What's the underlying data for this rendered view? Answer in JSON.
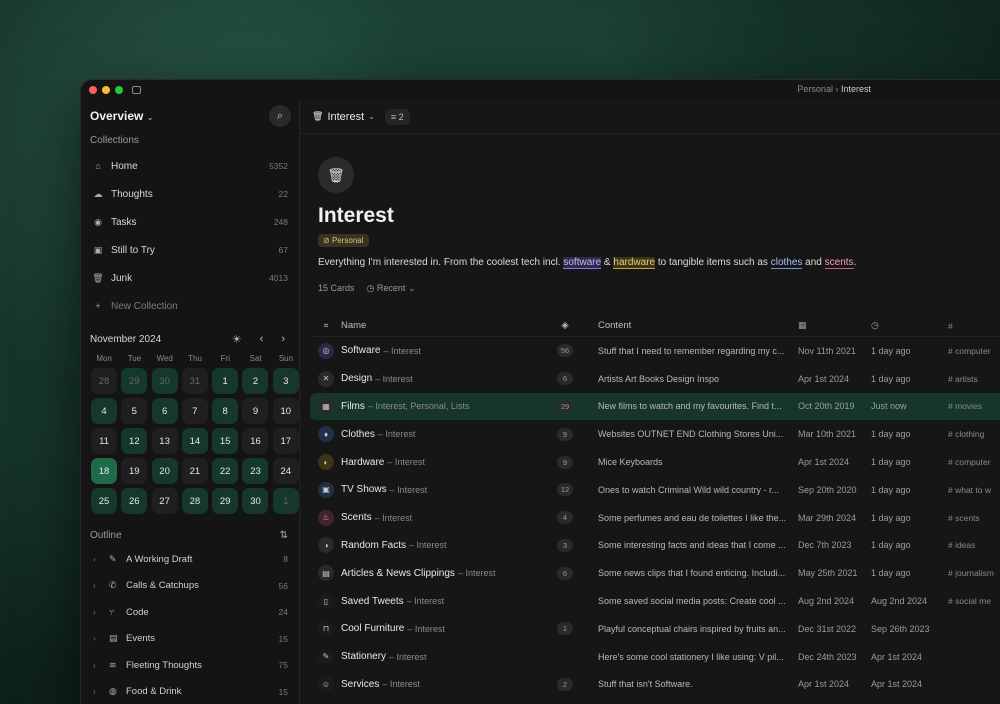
{
  "window": {
    "breadcrumb": {
      "parent": "Personal",
      "separator": "›",
      "current": "Interest"
    }
  },
  "sidebar": {
    "title": "Overview",
    "collections_label": "Collections",
    "collections": [
      {
        "label": "Home",
        "count": "5352",
        "icon": "⌂"
      },
      {
        "label": "Thoughts",
        "count": "22",
        "icon": "☁"
      },
      {
        "label": "Tasks",
        "count": "248",
        "icon": "◉"
      },
      {
        "label": "Still to Try",
        "count": "67",
        "icon": "▣"
      },
      {
        "label": "Junk",
        "count": "4013",
        "icon": "🗑"
      }
    ],
    "new_collection": "New Collection",
    "calendar": {
      "month": "November 2024",
      "weekdays": [
        "Mon",
        "Tue",
        "Wed",
        "Thu",
        "Fri",
        "Sat",
        "Sun"
      ],
      "days": [
        {
          "d": "28",
          "s": "muted"
        },
        {
          "d": "29",
          "s": "muted g"
        },
        {
          "d": "30",
          "s": "muted g"
        },
        {
          "d": "31",
          "s": "muted"
        },
        {
          "d": "1",
          "s": "g"
        },
        {
          "d": "2",
          "s": "g"
        },
        {
          "d": "3",
          "s": "g"
        },
        {
          "d": "4",
          "s": "g"
        },
        {
          "d": "5",
          "s": ""
        },
        {
          "d": "6",
          "s": "g"
        },
        {
          "d": "7",
          "s": ""
        },
        {
          "d": "8",
          "s": "g"
        },
        {
          "d": "9",
          "s": ""
        },
        {
          "d": "10",
          "s": ""
        },
        {
          "d": "11",
          "s": ""
        },
        {
          "d": "12",
          "s": "g"
        },
        {
          "d": "13",
          "s": ""
        },
        {
          "d": "14",
          "s": "g"
        },
        {
          "d": "15",
          "s": "g"
        },
        {
          "d": "16",
          "s": ""
        },
        {
          "d": "17",
          "s": ""
        },
        {
          "d": "18",
          "s": "hl"
        },
        {
          "d": "19",
          "s": ""
        },
        {
          "d": "20",
          "s": "g"
        },
        {
          "d": "21",
          "s": ""
        },
        {
          "d": "22",
          "s": "g"
        },
        {
          "d": "23",
          "s": "g"
        },
        {
          "d": "24",
          "s": ""
        },
        {
          "d": "25",
          "s": "g"
        },
        {
          "d": "26",
          "s": "g"
        },
        {
          "d": "27",
          "s": ""
        },
        {
          "d": "28",
          "s": "g"
        },
        {
          "d": "29",
          "s": "g"
        },
        {
          "d": "30",
          "s": "g"
        },
        {
          "d": "1",
          "s": "muted g"
        }
      ]
    },
    "outline_label": "Outline",
    "outline": [
      {
        "label": "A Working Draft",
        "count": "8",
        "icon": "✎"
      },
      {
        "label": "Calls & Catchups",
        "count": "56",
        "icon": "✆"
      },
      {
        "label": "Code",
        "count": "24",
        "icon": "⑂"
      },
      {
        "label": "Events",
        "count": "15",
        "icon": "▤"
      },
      {
        "label": "Fleeting Thoughts",
        "count": "75",
        "icon": "≋"
      },
      {
        "label": "Food & Drink",
        "count": "15",
        "icon": "◍"
      }
    ]
  },
  "main": {
    "toolbar": {
      "title": "Interest",
      "filter_count": "2"
    },
    "title": "Interest",
    "tag": "Personal",
    "description": {
      "p1": "Everything I'm interested in. From the coolest tech incl. ",
      "software": "software",
      "amp": " & ",
      "hardware": "hardware",
      "p2": " to tangible items such as ",
      "clothes": "clothes",
      "and": " and ",
      "scents": "scents",
      "end": "."
    },
    "meta": {
      "cards": "15 Cards",
      "sort": "Recent"
    },
    "columns": {
      "name": "Name",
      "content": "Content"
    },
    "rows": [
      {
        "name": "Software",
        "parent": "– Interest",
        "count": "56",
        "content": "Stuff that I need to remember regarding my c...",
        "created": "Nov 11th 2021",
        "updated": "1 day ago",
        "tag": "# computer",
        "icon": "◎",
        "color": "#2e2746",
        "sel": false
      },
      {
        "name": "Design",
        "parent": "– Interest",
        "count": "6",
        "content": "Artists Art Books Design Inspo",
        "created": "Apr 1st 2024",
        "updated": "1 day ago",
        "tag": "# artists",
        "icon": "✕",
        "color": "#2a2a2a",
        "sel": false
      },
      {
        "name": "Films",
        "parent": "– Interest, Personal, Lists",
        "count": "29",
        "content": "New films to watch and my favourites. Find t...",
        "created": "Oct 20th 2019",
        "updated": "Just now",
        "tag": "# movies",
        "icon": "▦",
        "color": "#2a2a2a",
        "sel": true
      },
      {
        "name": "Clothes",
        "parent": "– Interest",
        "count": "9",
        "content": "Websites OUTNET END Clothing Stores Uni...",
        "created": "Mar 10th 2021",
        "updated": "1 day ago",
        "tag": "# clothing",
        "icon": "♦",
        "color": "#203049",
        "sel": false
      },
      {
        "name": "Hardware",
        "parent": "– Interest",
        "count": "9",
        "content": "Mice Keyboards",
        "created": "Apr 1st 2024",
        "updated": "1 day ago",
        "tag": "# computer",
        "icon": "◐",
        "color": "#3d3418",
        "sel": false
      },
      {
        "name": "TV Shows",
        "parent": "– Interest",
        "count": "12",
        "content": "Ones to watch Criminal Wild wild country - r...",
        "created": "Sep 20th 2020",
        "updated": "1 day ago",
        "tag": "# what to w",
        "icon": "▣",
        "color": "#203049",
        "sel": false
      },
      {
        "name": "Scents",
        "parent": "– Interest",
        "count": "4",
        "content": "Some perfumes and eau de toilettes I like the...",
        "created": "Mar 29th 2024",
        "updated": "1 day ago",
        "tag": "# scents",
        "icon": "♨",
        "color": "#46232c",
        "sel": false
      },
      {
        "name": "Random Facts",
        "parent": "– Interest",
        "count": "3",
        "content": "Some interesting facts and ideas that I come ...",
        "created": "Dec 7th 2023",
        "updated": "1 day ago",
        "tag": "# ideas",
        "icon": "◑",
        "color": "#2a2a2a",
        "sel": false
      },
      {
        "name": "Articles & News Clippings",
        "parent": "– Interest",
        "count": "6",
        "content": "Some news clips that I found enticing. Includi...",
        "created": "May 25th 2021",
        "updated": "1 day ago",
        "tag": "# journalism",
        "icon": "▤",
        "color": "#2a2a2a",
        "sel": false
      },
      {
        "name": "Saved Tweets",
        "parent": "– Interest",
        "count": "",
        "content": "Some saved social media posts: Create cool ...",
        "created": "Aug 2nd 2024",
        "updated": "Aug 2nd 2024",
        "tag": "# social me",
        "icon": "▯",
        "color": "#1b1b1b",
        "sel": false
      },
      {
        "name": "Cool Furniture",
        "parent": "– Interest",
        "count": "1",
        "content": "Playful conceptual chairs inspired by fruits an...",
        "created": "Dec 31st 2022",
        "updated": "Sep 26th 2023",
        "tag": "",
        "icon": "⊓",
        "color": "#1b1b1b",
        "sel": false
      },
      {
        "name": "Stationery",
        "parent": "– Interest",
        "count": "",
        "content": "Here's some cool stationery I like using: V pil...",
        "created": "Dec 24th 2023",
        "updated": "Apr 1st 2024",
        "tag": "",
        "icon": "✎",
        "color": "#1b1b1b",
        "sel": false
      },
      {
        "name": "Services",
        "parent": "– Interest",
        "count": "2",
        "content": "Stuff that isn't Software.",
        "created": "Apr 1st 2024",
        "updated": "Apr 1st 2024",
        "tag": "",
        "icon": "☺",
        "color": "#1b1b1b",
        "sel": false
      }
    ]
  }
}
